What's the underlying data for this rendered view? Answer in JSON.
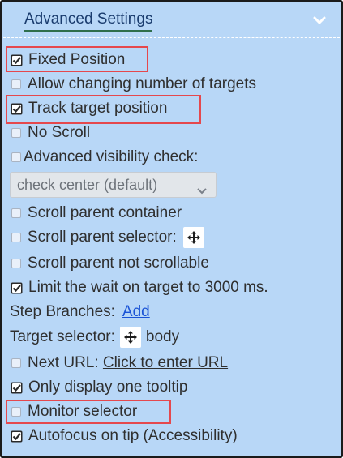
{
  "header": {
    "title": "Advanced Settings",
    "chevron_icon": "chevron-down-icon"
  },
  "options": {
    "fixed_position": {
      "label": "Fixed Position",
      "checked": true
    },
    "allow_changing_targets": {
      "label": "Allow changing number of targets",
      "checked": false
    },
    "track_target_position": {
      "label": "Track target position",
      "checked": true
    },
    "no_scroll": {
      "label": "No Scroll",
      "checked": false
    },
    "advanced_visibility": {
      "label": "Advanced visibility check:",
      "checked": false
    },
    "scroll_parent_container": {
      "label": "Scroll parent container",
      "checked": false
    },
    "scroll_parent_selector": {
      "label": "Scroll parent selector:",
      "checked": false
    },
    "scroll_parent_not_scrollable": {
      "label": "Scroll parent not scrollable",
      "checked": false
    },
    "limit_wait": {
      "label_prefix": "Limit the wait on target to ",
      "value": "3000 ms.",
      "checked": true
    },
    "next_url": {
      "label_prefix": "Next URL: ",
      "link": "Click to enter URL",
      "checked": false
    },
    "only_one_tooltip": {
      "label": "Only display one tooltip",
      "checked": true
    },
    "monitor_selector": {
      "label": "Monitor selector",
      "checked": false
    },
    "autofocus_tip": {
      "label": "Autofocus on tip (Accessibility)",
      "checked": true
    }
  },
  "visibility_select": {
    "value": "check center (default)"
  },
  "step_branches": {
    "label": "Step Branches:",
    "link": "Add"
  },
  "target_selector": {
    "label": "Target selector:",
    "value": "body"
  },
  "colors": {
    "panel": "#b8d7f7",
    "highlight": "#e5484d",
    "link": "#1a53d6"
  }
}
